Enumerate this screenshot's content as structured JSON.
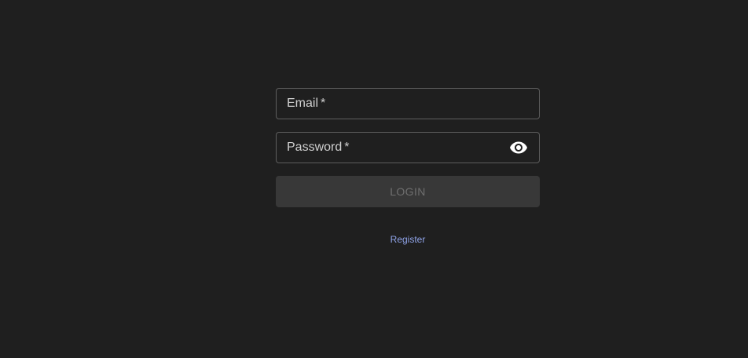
{
  "form": {
    "email": {
      "label": "Email",
      "required_mark": "*",
      "value": ""
    },
    "password": {
      "label": "Password",
      "required_mark": "*",
      "value": "",
      "toggle_icon": "eye-icon"
    },
    "login_label": "LOGIN",
    "register_label": "Register"
  },
  "colors": {
    "background": "#1f1f1f",
    "field_border": "#5e5e5e",
    "button_disabled_bg": "#383838",
    "button_disabled_text": "#6f6f6f",
    "link": "#8ea2e6"
  }
}
